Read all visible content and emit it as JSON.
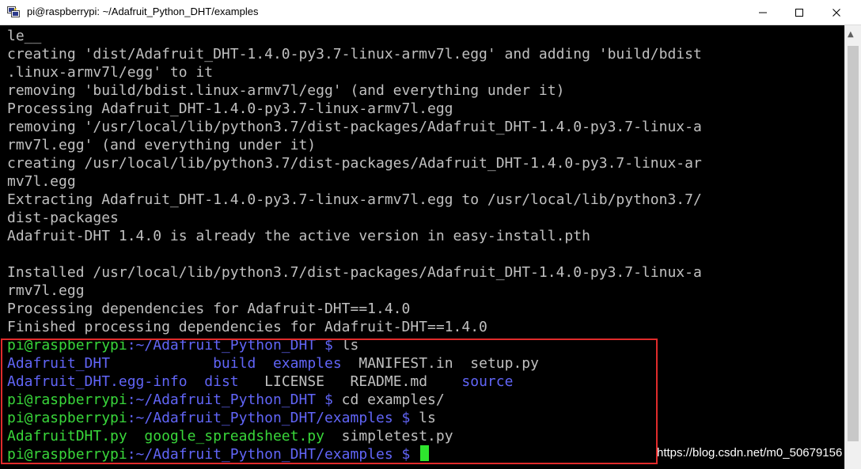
{
  "window": {
    "title": "pi@raspberrypi: ~/Adafruit_Python_DHT/examples",
    "minimize_symbol": "—",
    "maximize_symbol": "☐",
    "close_symbol": "✕"
  },
  "terminal": {
    "output_lines": [
      "le__",
      "creating 'dist/Adafruit_DHT-1.4.0-py3.7-linux-armv7l.egg' and adding 'build/bdist",
      ".linux-armv7l/egg' to it",
      "removing 'build/bdist.linux-armv7l/egg' (and everything under it)",
      "Processing Adafruit_DHT-1.4.0-py3.7-linux-armv7l.egg",
      "removing '/usr/local/lib/python3.7/dist-packages/Adafruit_DHT-1.4.0-py3.7-linux-a",
      "rmv7l.egg' (and everything under it)",
      "creating /usr/local/lib/python3.7/dist-packages/Adafruit_DHT-1.4.0-py3.7-linux-ar",
      "mv7l.egg",
      "Extracting Adafruit_DHT-1.4.0-py3.7-linux-armv7l.egg to /usr/local/lib/python3.7/",
      "dist-packages",
      "Adafruit-DHT 1.4.0 is already the active version in easy-install.pth",
      "",
      "Installed /usr/local/lib/python3.7/dist-packages/Adafruit_DHT-1.4.0-py3.7-linux-a",
      "rmv7l.egg",
      "Processing dependencies for Adafruit-DHT==1.4.0",
      "Finished processing dependencies for Adafruit-DHT==1.4.0"
    ],
    "session": {
      "prompt1": {
        "user": "pi@raspberrypi",
        "path": ":~/Adafruit_Python_DHT $",
        "cmd": " ls"
      },
      "ls1_row1": {
        "a": "Adafruit_DHT",
        "sp_a": "            ",
        "b": "build",
        "sp_b": "  ",
        "c": "examples",
        "sp_c": "  ",
        "d": "MANIFEST.in",
        "sp_d": "  ",
        "e": "setup.py"
      },
      "ls1_row2": {
        "a": "Adafruit_DHT.egg-info",
        "sp_a": "  ",
        "b": "dist",
        "sp_b": "   ",
        "c": "LICENSE",
        "sp_c": "   ",
        "d": "README.md",
        "sp_d": "    ",
        "e": "source"
      },
      "prompt2": {
        "user": "pi@raspberrypi",
        "path": ":~/Adafruit_Python_DHT $",
        "cmd": " cd examples/"
      },
      "prompt3": {
        "user": "pi@raspberrypi",
        "path": ":~/Adafruit_Python_DHT/examples $",
        "cmd": " ls"
      },
      "ls2_row": {
        "a": "AdafruitDHT.py",
        "sp_a": "  ",
        "b": "google_spreadsheet.py",
        "sp_b": "  ",
        "c": "simpletest.py"
      },
      "prompt4": {
        "user": "pi@raspberrypi",
        "path": ":~/Adafruit_Python_DHT/examples $",
        "cmd": " "
      }
    }
  },
  "watermark": "https://blog.csdn.net/m0_50679156",
  "colors": {
    "background": "#000000",
    "text": "#c0c0c0",
    "prompt_user": "#39d73a",
    "prompt_path": "#6165f7",
    "executable": "#39d73a",
    "directory": "#6165f7",
    "cursor": "#2ee52e",
    "highlight_border": "#e02b2b"
  },
  "icons": {
    "app": "putty-icon",
    "minimize": "minimize-icon",
    "maximize": "maximize-icon",
    "close": "close-icon"
  }
}
